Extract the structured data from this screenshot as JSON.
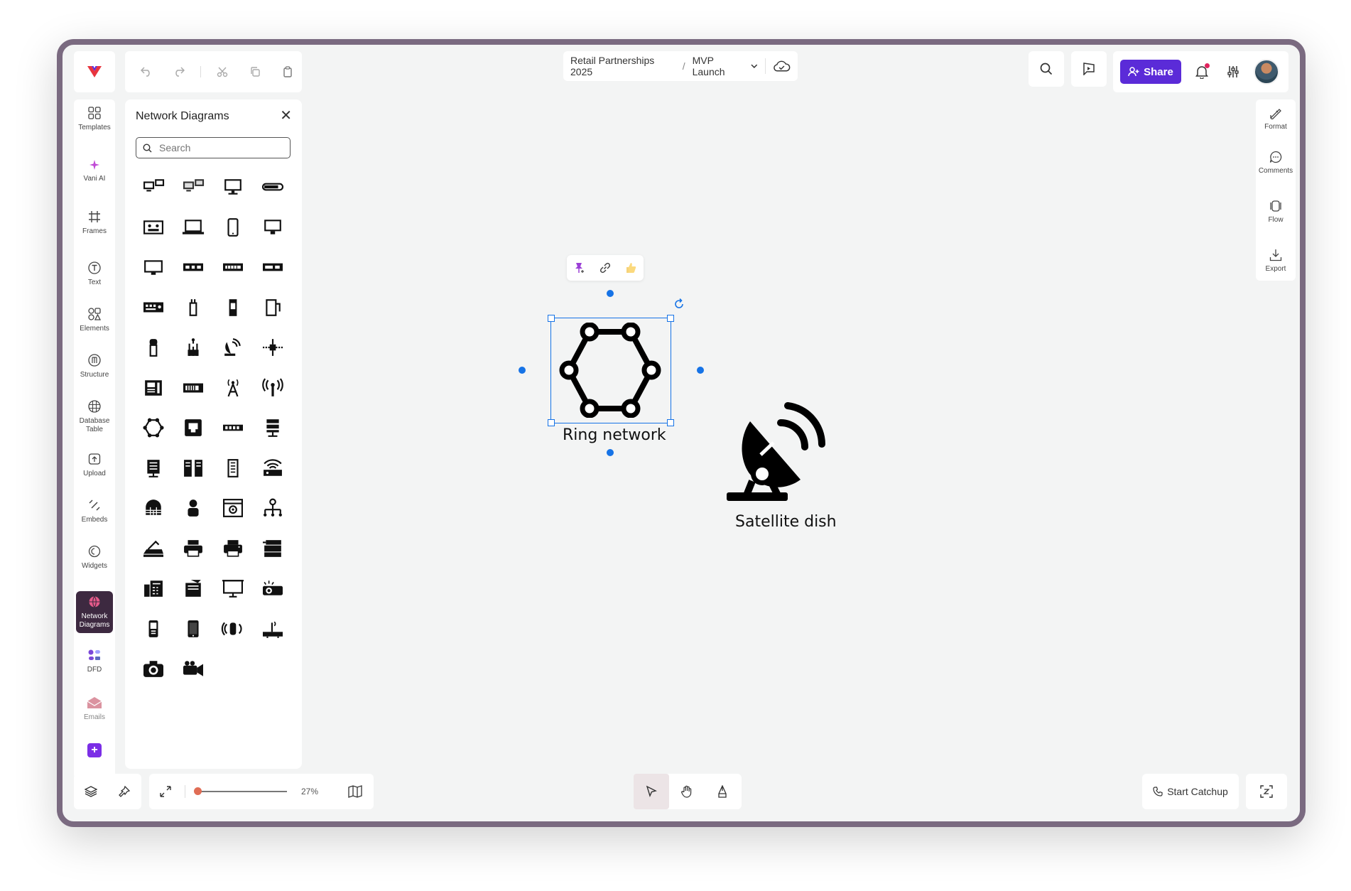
{
  "header": {
    "breadcrumb_parent": "Retail Partnerships 2025",
    "breadcrumb_separator": "/",
    "breadcrumb_current": "MVP Launch",
    "share_label": "Share"
  },
  "left_nav": {
    "items": [
      {
        "label": "Templates",
        "icon": "grid-icon"
      },
      {
        "label": "Vani AI",
        "icon": "sparkle-icon"
      },
      {
        "label": "Frames",
        "icon": "hash-icon"
      },
      {
        "label": "Text",
        "icon": "text-icon"
      },
      {
        "label": "Elements",
        "icon": "shapes-icon"
      },
      {
        "label": "Structure",
        "icon": "structure-icon"
      },
      {
        "label": "Database Table",
        "icon": "table-icon"
      },
      {
        "label": "Upload",
        "icon": "upload-icon"
      },
      {
        "label": "Embeds",
        "icon": "embed-icon"
      },
      {
        "label": "Widgets",
        "icon": "widget-icon"
      },
      {
        "label": "Network Diagrams",
        "icon": "globe-icon",
        "active": true
      },
      {
        "label": "DFD",
        "icon": "dfd-icon"
      },
      {
        "label": "Emails",
        "icon": "mail-icon"
      }
    ]
  },
  "panel": {
    "title": "Network Diagrams",
    "search_placeholder": "Search",
    "shape_count": 50
  },
  "right_nav": {
    "items": [
      {
        "label": "Format",
        "icon": "format-icon"
      },
      {
        "label": "Comments",
        "icon": "comment-icon"
      },
      {
        "label": "Flow",
        "icon": "flow-icon"
      },
      {
        "label": "Export",
        "icon": "download-icon"
      }
    ]
  },
  "bottom": {
    "zoom_label": "27%",
    "zoom_fraction": 0.02,
    "catchup_label": "Start Catchup"
  },
  "canvas": {
    "ring_label": "Ring network",
    "dish_label": "Satellite dish"
  },
  "colors": {
    "accent": "#5b2bd8",
    "selection": "#1673e6",
    "active_nav": "#3d2940",
    "frame_border": "#7a6a80",
    "notification_dot": "#e0245e"
  }
}
